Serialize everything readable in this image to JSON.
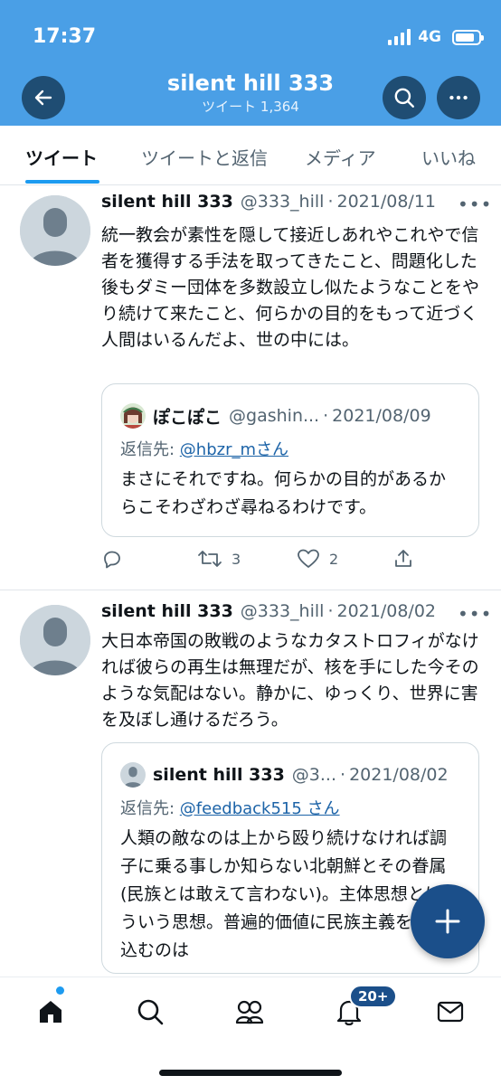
{
  "status_bar": {
    "time": "17:37",
    "network": "4G"
  },
  "header": {
    "title": "silent hill 333",
    "subtitle": "ツイート 1,364",
    "icons": {
      "back": "arrow-left-icon",
      "search": "search-icon",
      "more": "more-horizontal-icon"
    }
  },
  "tabs": [
    {
      "label": "ツイート",
      "active": true
    },
    {
      "label": "ツイートと返信",
      "active": false
    },
    {
      "label": "メディア",
      "active": false
    },
    {
      "label": "いいね",
      "active": false
    }
  ],
  "tweets": [
    {
      "name": "silent hill 333",
      "handle": "@333_hill",
      "sep": "·",
      "date": "2021/08/11",
      "more": "•••",
      "text": "統一教会が素性を隠して接近しあれやこれやで信者を獲得する手法を取ってきたこと、問題化した後もダミー団体を多数設立し似たようなことをやり続けて来たこと、何らかの目的をもって近づく人間はいるんだよ、世の中には。",
      "quote": {
        "name": "ぽこぽこ",
        "handle": "@gashin...",
        "sep": "·",
        "date": "2021/08/09",
        "reply_prefix": "返信先: ",
        "reply_mention": "@hbzr_mさん",
        "text": "まさにそれですね。何らかの目的があるからこそわざわざ尋ねるわけです。"
      },
      "actions": {
        "reply_count": "",
        "retweet_count": "3",
        "like_count": "2"
      }
    },
    {
      "name": "silent hill 333",
      "handle": "@333_hill",
      "sep": "·",
      "date": "2021/08/02",
      "more": "•••",
      "text": "大日本帝国の敗戦のようなカタストロフィがなければ彼らの再生は無理だが、核を手にした今そのような気配はない。静かに、ゆっくり、世界に害を及ぼし通けるだろう。",
      "quote": {
        "name": "silent hill 333",
        "handle": "@3...",
        "sep": "·",
        "date": "2021/08/02",
        "reply_prefix": "返信先: ",
        "reply_mention": "@feedback515 さん",
        "text": "人類の敵なのは上から殴り続けなければ調子に乗る事しか知らない北朝鮮とその眷属 (民族とは敢えて言わない)。主体思想とはそういう思想。普遍的価値に民族主義を混ぜ込むのは"
      }
    }
  ],
  "bottom_nav": {
    "items": [
      "home-icon",
      "search-icon",
      "communities-icon",
      "bell-icon",
      "mail-icon"
    ],
    "notification_badge": "20+"
  },
  "fab": {
    "icon": "plus-icon"
  },
  "colors": {
    "header_bg": "#4a9fe6",
    "accent": "#1d9bf0",
    "fab": "#1b4f8a",
    "mention": "#1d64a8"
  }
}
